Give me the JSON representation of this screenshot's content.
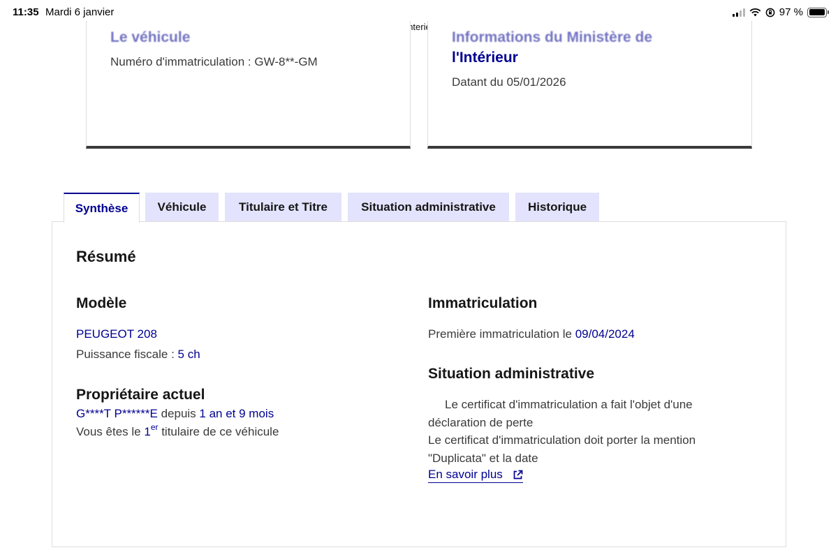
{
  "status_bar": {
    "time": "11:35",
    "date": "Mardi 6 janvier",
    "url": "histovec.interieur.gouv.fr",
    "battery": "97 %",
    "battery_level": 0.97
  },
  "cards": {
    "vehicle": {
      "title": "Le véhicule",
      "plate_text": "Numéro d'immatriculation : GW-8**-GM"
    },
    "ministry": {
      "title_line1": "Informations du Ministère de",
      "title_line2": "l'Intérieur",
      "date_text": "Datant du 05/01/2026"
    }
  },
  "tabs": [
    {
      "label": "Synthèse",
      "active": true
    },
    {
      "label": "Véhicule",
      "active": false
    },
    {
      "label": "Titulaire et Titre",
      "active": false
    },
    {
      "label": "Situation administrative",
      "active": false
    },
    {
      "label": "Historique",
      "active": false
    }
  ],
  "summary": {
    "title": "Résumé",
    "model": {
      "heading": "Modèle",
      "name": "PEUGEOT 208",
      "power_label": "Puissance fiscale : ",
      "power_value": "5 ch"
    },
    "owner": {
      "heading": "Propriétaire actuel",
      "name": "G****T P******E",
      "since_label": " depuis ",
      "since_value": "1 an et 9 mois",
      "holder_prefix": "Vous êtes le ",
      "holder_rank": "1",
      "holder_sup": "er",
      "holder_suffix": " titulaire de ce véhicule"
    },
    "registration": {
      "heading": "Immatriculation",
      "first_label": "Première immatriculation le ",
      "first_date": "09/04/2024"
    },
    "admin": {
      "heading": "Situation administrative",
      "line1": "Le certificat d'immatriculation a fait l'objet d'une",
      "line2": "déclaration de perte",
      "line3": "Le certificat d'immatriculation doit porter la mention",
      "line4": "\"Duplicata\" et la date",
      "link_label": "En savoir plus"
    }
  },
  "colors": {
    "primary_blue": "#000091",
    "tab_bg": "#e3e3fd",
    "text": "#3a3a3a"
  }
}
